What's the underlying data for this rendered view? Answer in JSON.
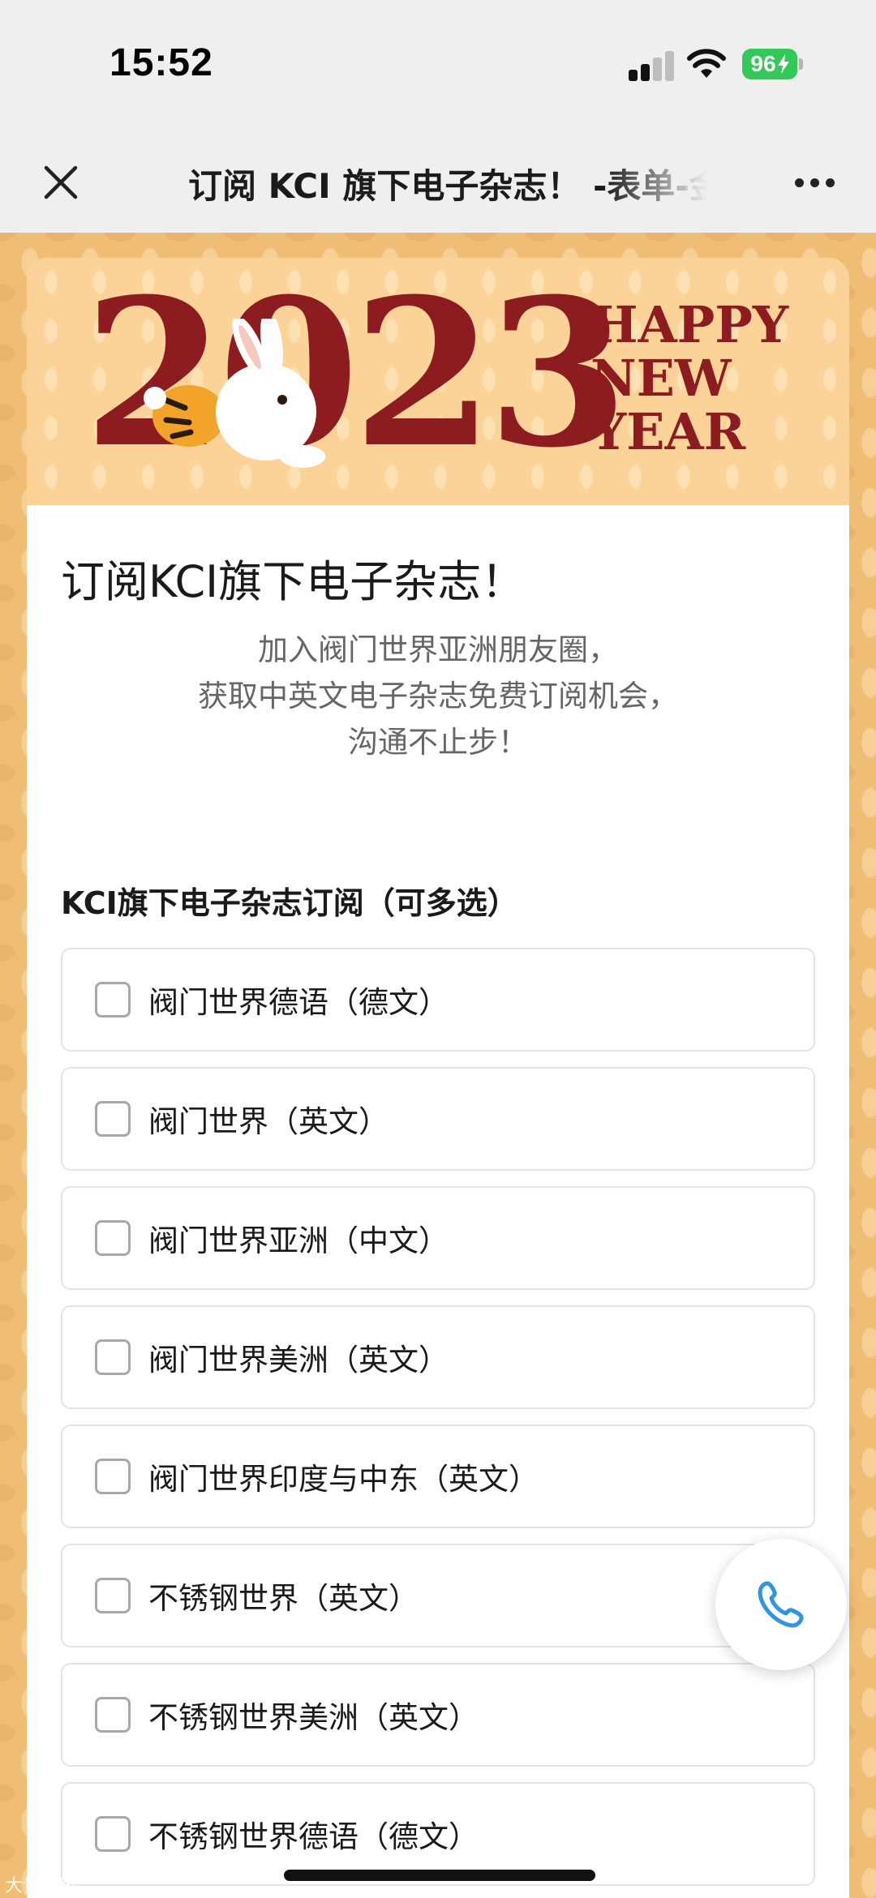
{
  "status_bar": {
    "time": "15:52",
    "battery": "96",
    "icons": [
      "signal-icon",
      "wifi-icon",
      "battery-icon"
    ]
  },
  "nav": {
    "title": "订阅 KCI 旗下电子杂志！ -表单-金数据",
    "close_icon": "close-icon",
    "more_icon": "more-icon"
  },
  "banner": {
    "year": "2023",
    "greeting": [
      "HAPPY",
      "NEW",
      "YEAR"
    ]
  },
  "form": {
    "title": "订阅KCI旗下电子杂志！",
    "description": [
      "加入阀门世界亚洲朋友圈，",
      "获取中英文电子杂志免费订阅机会，",
      "沟通不止步！"
    ],
    "section_label": "KCI旗下电子杂志订阅（可多选）",
    "options": [
      {
        "label": "阀门世界德语（德文）",
        "checked": false
      },
      {
        "label": "阀门世界（英文）",
        "checked": false
      },
      {
        "label": "阀门世界亚洲（中文）",
        "checked": false
      },
      {
        "label": "阀门世界美洲（英文）",
        "checked": false
      },
      {
        "label": "阀门世界印度与中东（英文）",
        "checked": false
      },
      {
        "label": "不锈钢世界（英文）",
        "checked": false
      },
      {
        "label": "不锈钢世界美洲（英文）",
        "checked": false
      },
      {
        "label": "不锈钢世界德语（德文）",
        "checked": false
      }
    ]
  },
  "fab": {
    "icon": "phone-icon"
  },
  "watermark": "大贵蛮级",
  "colors": {
    "accent_red": "#8c1c1f",
    "background_gold": "#efbd74",
    "banner": "#fbd399",
    "battery_green": "#34c759",
    "phone_blue": "#2f95dc"
  }
}
